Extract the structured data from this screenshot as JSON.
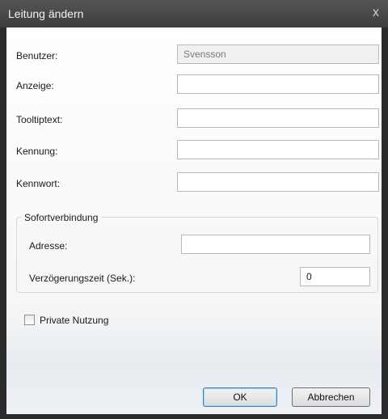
{
  "window": {
    "title": "Leitung ändern",
    "close_glyph": "x"
  },
  "fields": {
    "benutzer_label": "Benutzer:",
    "benutzer_value": "Svensson",
    "anzeige_label": "Anzeige:",
    "anzeige_value": "",
    "tooltiptext_label": "Tooltiptext:",
    "tooltiptext_value": "",
    "kennung_label": "Kennung:",
    "kennung_value": "",
    "kennwort_label": "Kennwort:",
    "kennwort_value": ""
  },
  "sofortverbindung": {
    "group_title": "Sofortverbindung",
    "adresse_label": "Adresse:",
    "adresse_value": "",
    "delay_label": "Verzögerungszeit (Sek.):",
    "delay_value": "0"
  },
  "private": {
    "label": "Private Nutzung",
    "checked": false
  },
  "buttons": {
    "ok": "OK",
    "cancel": "Abbrechen"
  }
}
